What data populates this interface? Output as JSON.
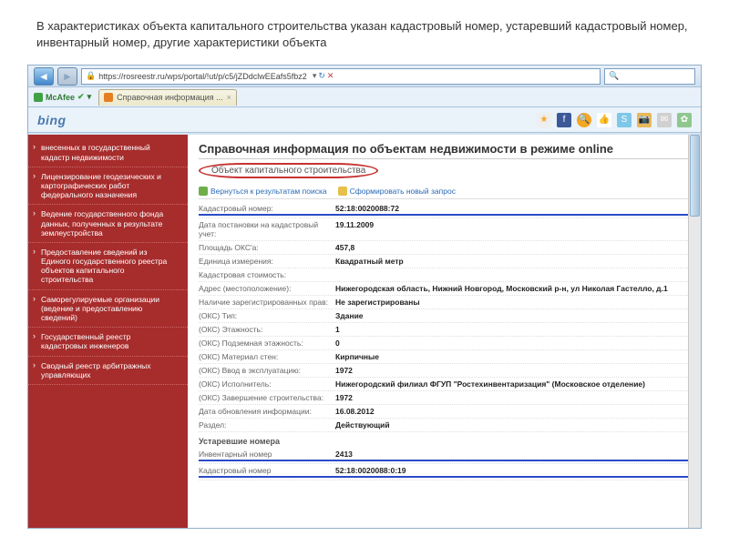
{
  "caption": "В характеристиках объекта капитального строительства указан кадастровый номер, устаревший кадастровый номер, инвентарный номер, другие характеристики объекта",
  "address_bar": {
    "url": "https://rosreestr.ru/wps/portal/!ut/p/c5/jZDdclwEEafs5fbz2"
  },
  "mcafee_label": "McAfee",
  "tab1_label": "Справочная информация ...",
  "bing_label": "bing",
  "sidebar": {
    "items": [
      "внесенных в государственный кадастр недвижимости",
      "Лицензирование геодезических и картографических работ федерального назначения",
      "Ведение государственного фонда данных, полученных в результате землеустройства",
      "Предоставление сведений из Единого государственного реестра объектов капитального строительства",
      "Саморегулируемые организации (ведение и предоставлению сведений)",
      "Государственный реестр кадастровых инженеров",
      "Сводный реестр арбитражных управляющих"
    ]
  },
  "main": {
    "title": "Справочная информация по объектам недвижимости в режиме online",
    "subtitle": "Объект капитального строительства",
    "back_link": "Вернуться к результатам поиска",
    "new_query": "Сформировать новый запрос",
    "rows": [
      {
        "label": "Кадастровый номер:",
        "value": "52:18:0020088:72",
        "hl": true
      },
      {
        "label": "Дата постановки на кадастровый учет:",
        "value": "19.11.2009"
      },
      {
        "label": "Площадь ОКС'а:",
        "value": "457,8"
      },
      {
        "label": "Единица измерения:",
        "value": "Квадратный метр"
      },
      {
        "label": "Кадастровая стоимость:",
        "value": ""
      },
      {
        "label": "Адрес (местоположение):",
        "value": "Нижегородская область, Нижний Новгород, Московский р-н, ул Николая Гастелло, д.1"
      },
      {
        "label": "Наличие зарегистрированных прав:",
        "value": "Не зарегистрированы"
      },
      {
        "label": "(ОКС) Тип:",
        "value": "Здание"
      },
      {
        "label": "(ОКС) Этажность:",
        "value": "1"
      },
      {
        "label": "(ОКС) Подземная этажность:",
        "value": "0"
      },
      {
        "label": "(ОКС) Материал стен:",
        "value": "Кирпичные"
      },
      {
        "label": "(ОКС) Ввод в эксплуатацию:",
        "value": "1972"
      },
      {
        "label": "(ОКС) Исполнитель:",
        "value": "Нижегородский филиал ФГУП \"Ростехинвентаризация\" (Московское отделение)"
      },
      {
        "label": "(ОКС) Завершение строительства:",
        "value": "1972"
      },
      {
        "label": "Дата обновления информации:",
        "value": "16.08.2012"
      },
      {
        "label": "Раздел:",
        "value": "Действующий"
      }
    ],
    "old_section": "Устаревшие номера",
    "old_rows": [
      {
        "label": "Инвентарный номер",
        "value": "2413",
        "hl": true
      },
      {
        "label": "Кадастровый номер",
        "value": "52:18:0020088:0:19",
        "hl": true
      }
    ]
  }
}
